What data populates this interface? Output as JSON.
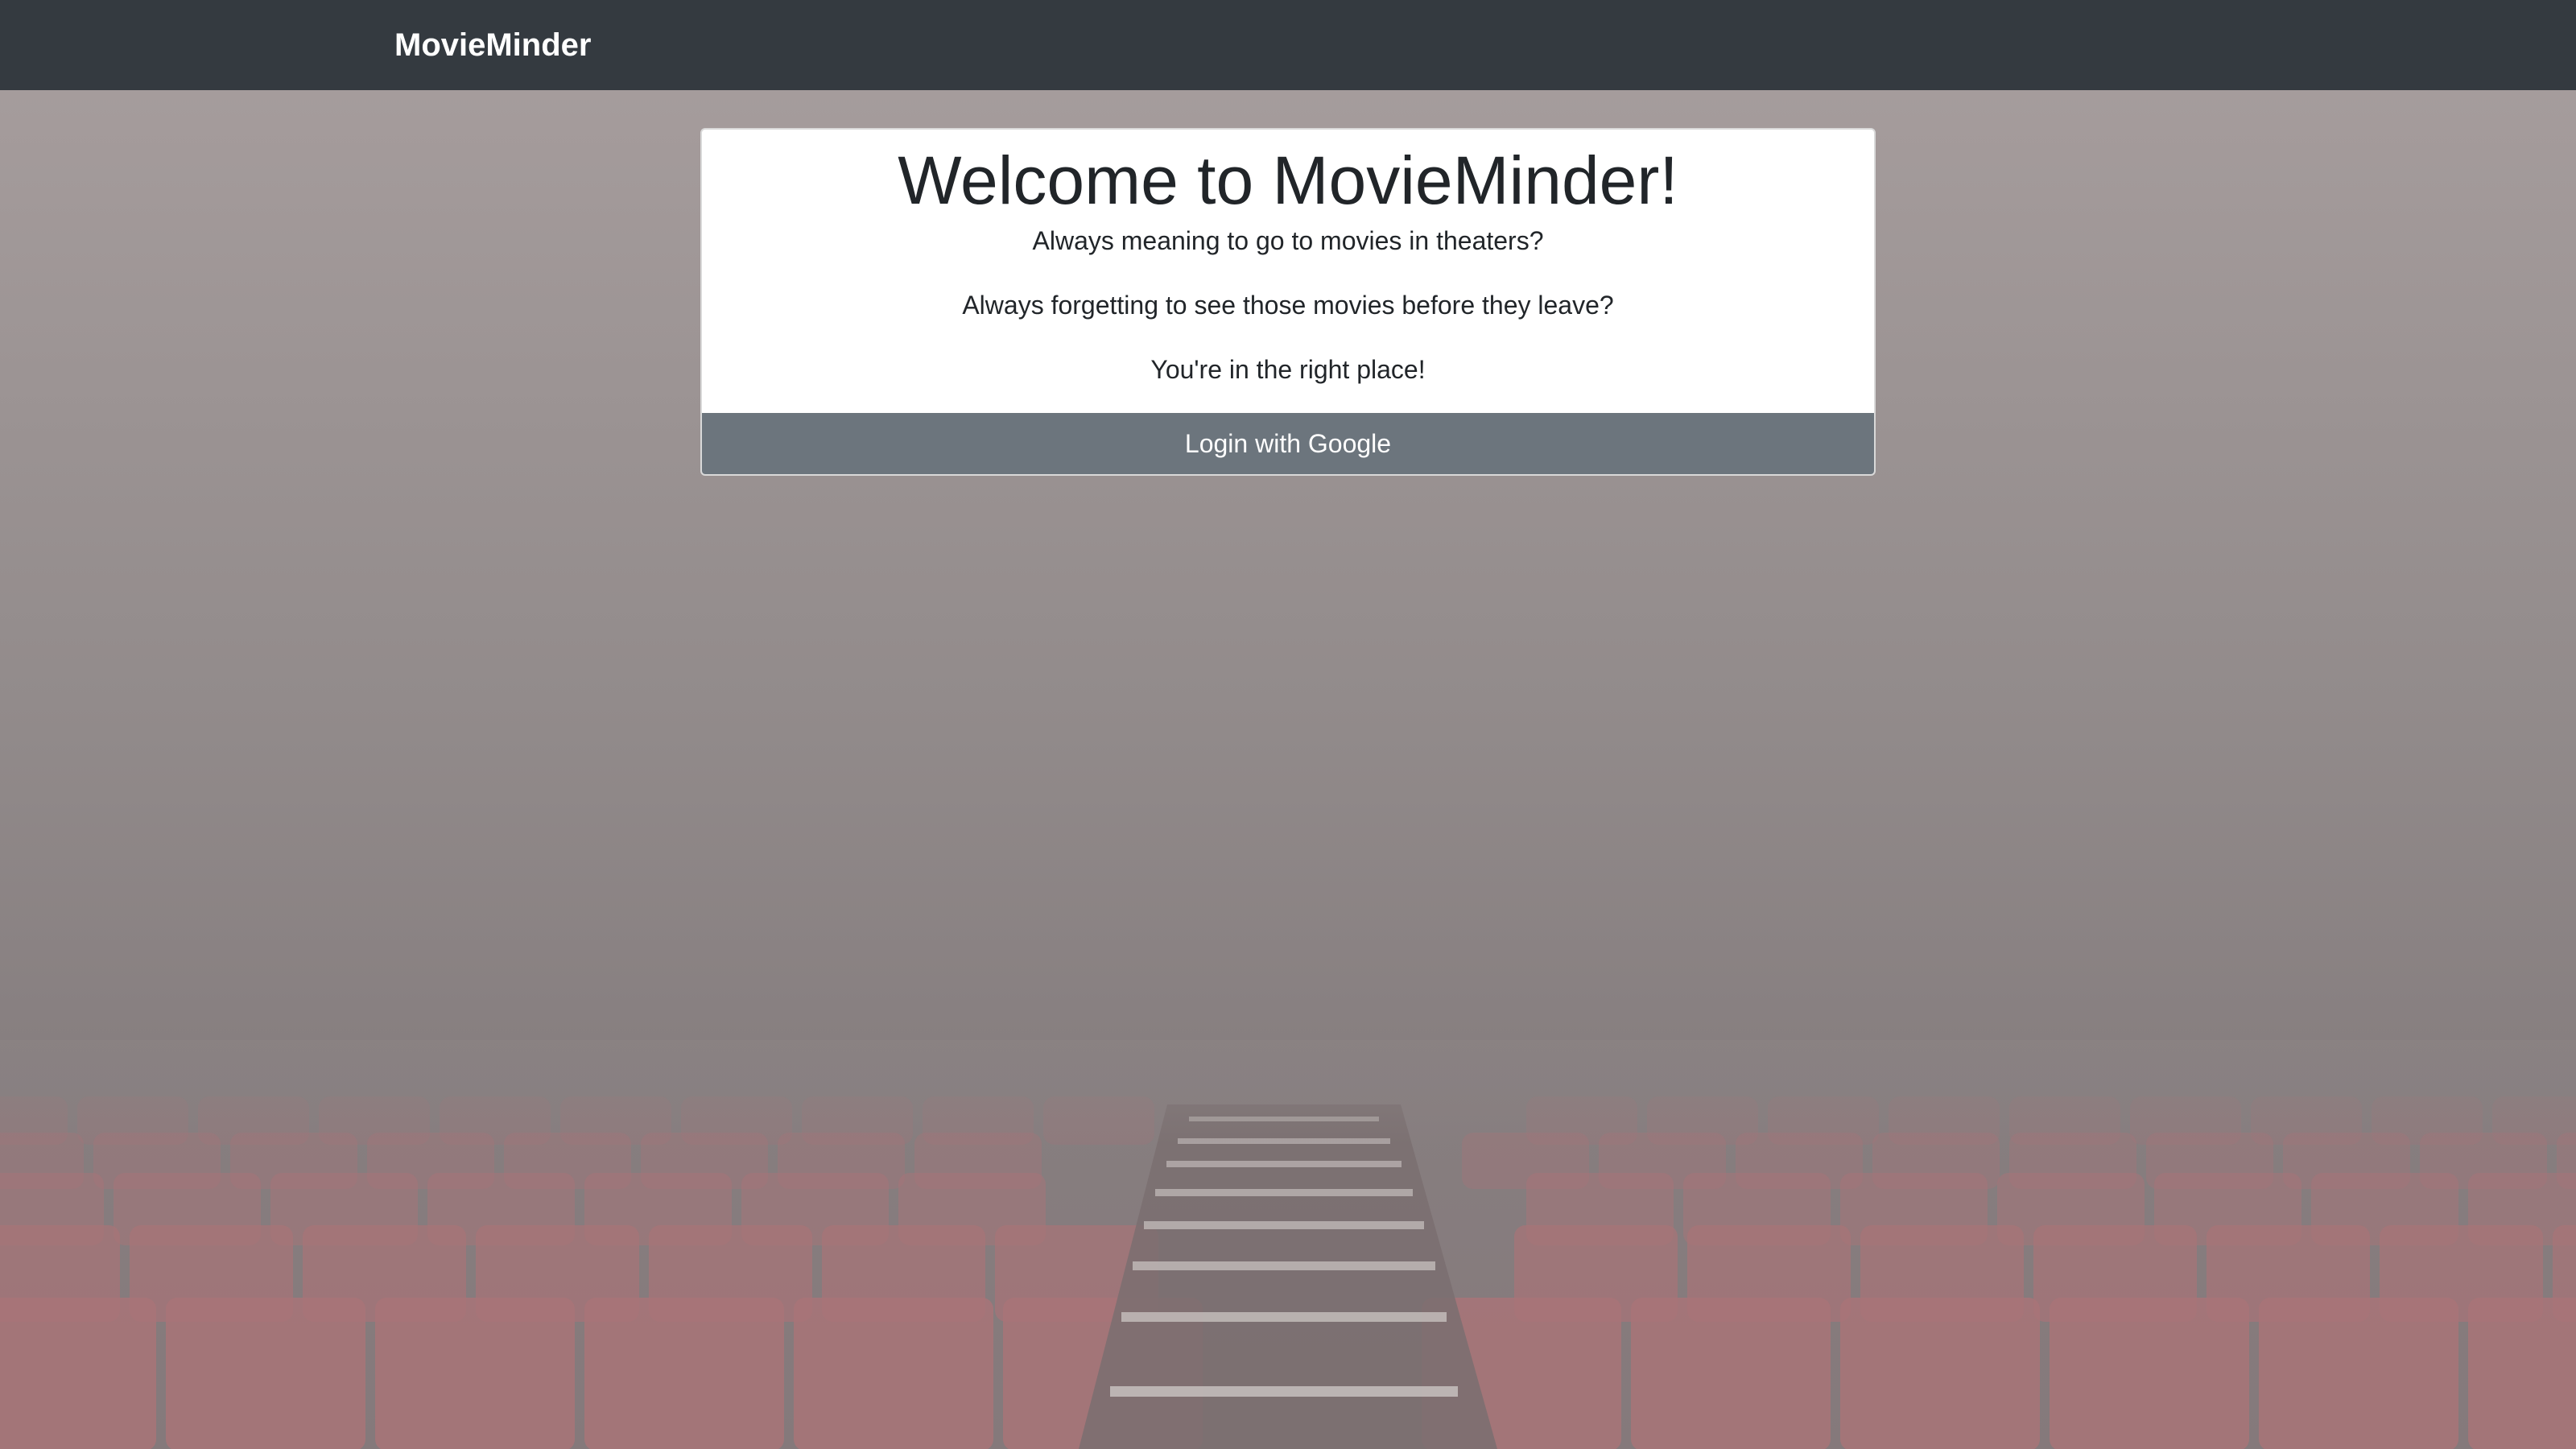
{
  "navbar": {
    "brand": "MovieMinder",
    "background": "#343a40"
  },
  "hero": {
    "title": "Welcome to MovieMinder!",
    "line1": "Always meaning to go to movies in theaters?",
    "line2": "Always forgetting to see those movies before they leave?",
    "line3": "You're in the right place!",
    "login_label": "Login with Google",
    "button_color": "#6c757d"
  },
  "background_image": {
    "subject": "foggy theater seats with center aisle stairs",
    "seat_color": "#a87478"
  }
}
